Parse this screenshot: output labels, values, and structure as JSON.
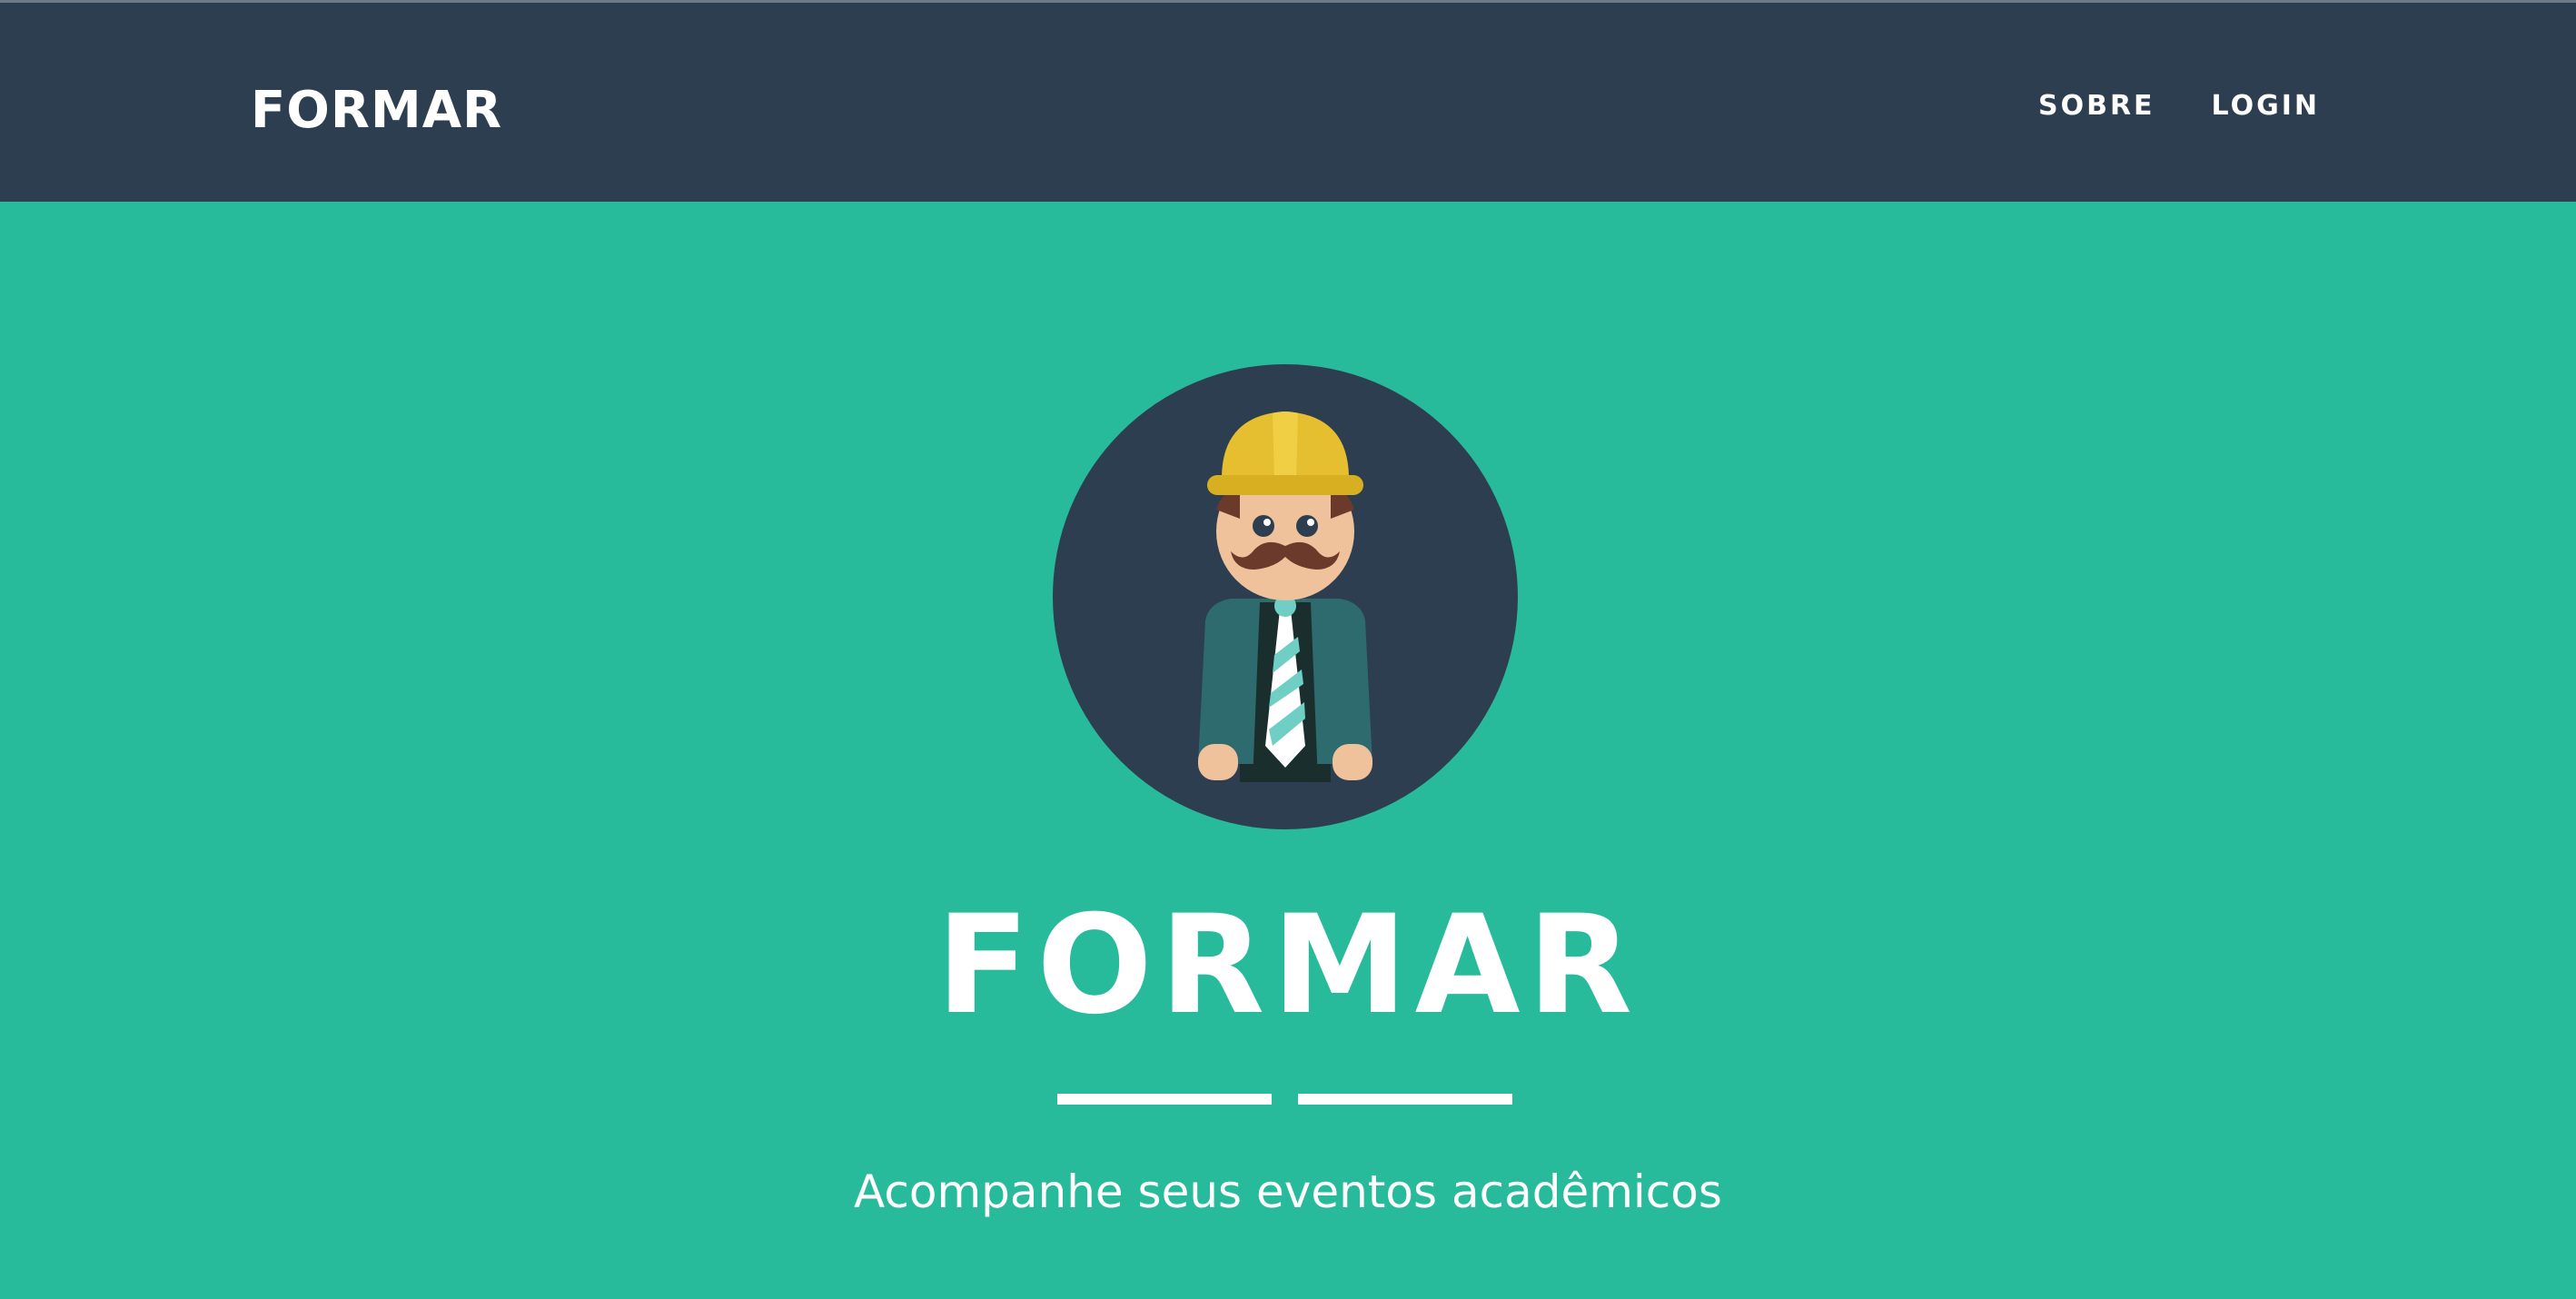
{
  "navbar": {
    "brand": "FORMAR",
    "links": [
      {
        "label": "SOBRE"
      },
      {
        "label": "LOGIN"
      }
    ],
    "background_color": "#2d3e50"
  },
  "hero": {
    "avatar_icon": "construction-worker-avatar-icon",
    "title": "FORMAR",
    "tagline": "Acompanhe seus eventos acadêmicos",
    "background_color": "#28bb9b",
    "text_color": "#ffffff"
  }
}
